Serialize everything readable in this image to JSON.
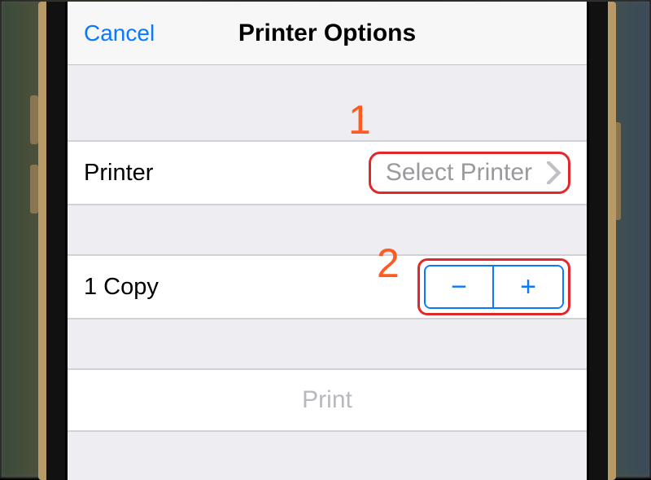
{
  "navbar": {
    "cancel": "Cancel",
    "title": "Printer Options"
  },
  "printer_row": {
    "label": "Printer",
    "value": "Select Printer"
  },
  "copies_row": {
    "label": "1 Copy",
    "minus": "−",
    "plus": "+"
  },
  "print_button": "Print",
  "annotations": {
    "one": "1",
    "two": "2"
  }
}
